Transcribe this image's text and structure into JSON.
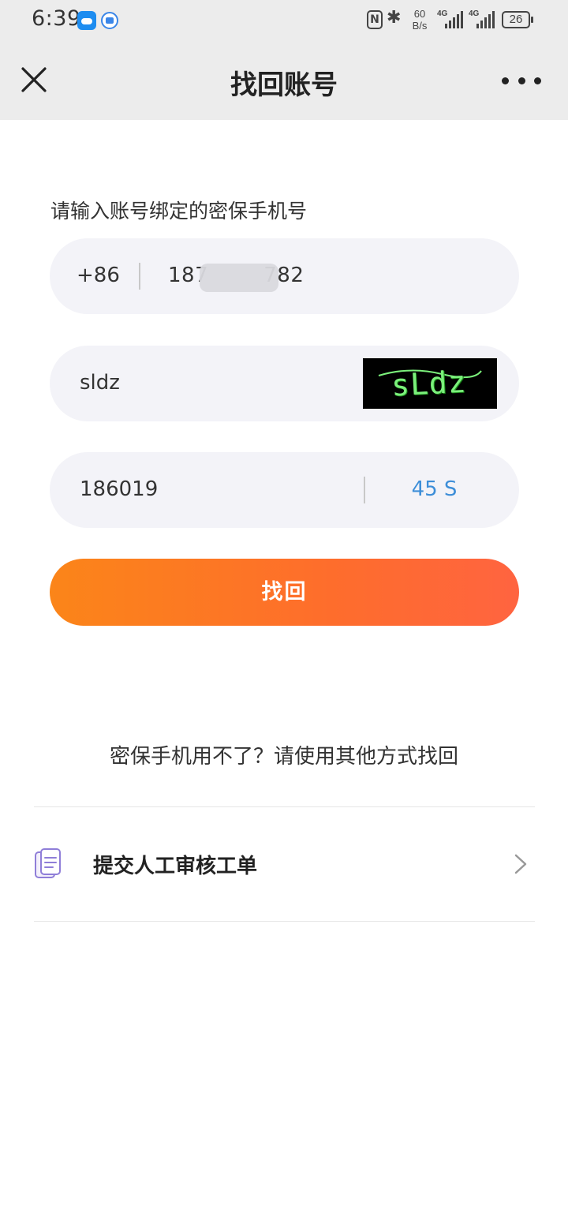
{
  "status_bar": {
    "time": "6:39",
    "net_speed_value": "60",
    "net_speed_unit": "B/s",
    "sim1_type": "4G",
    "sim2_type": "4G",
    "battery": "26"
  },
  "nav": {
    "title": "找回账号",
    "close_icon": "close-icon",
    "more_icon": "more-icon"
  },
  "form": {
    "prompt": "请输入账号绑定的密保手机号",
    "country_code": "+86",
    "phone_value": "187        782",
    "captcha_value": "sldz",
    "captcha_image_text": "sLdz",
    "sms_code_value": "186019",
    "countdown": "45 S",
    "submit_label": "找回"
  },
  "alternative": {
    "hint": "密保手机用不了？请使用其他方式找回",
    "manual_review_label": "提交人工审核工单"
  },
  "colors": {
    "accent_blue": "#3d8ed8",
    "button_gradient_start": "#fb8519",
    "button_gradient_end": "#ff6440",
    "field_background": "#f3f3f8",
    "header_background": "#ececec"
  }
}
